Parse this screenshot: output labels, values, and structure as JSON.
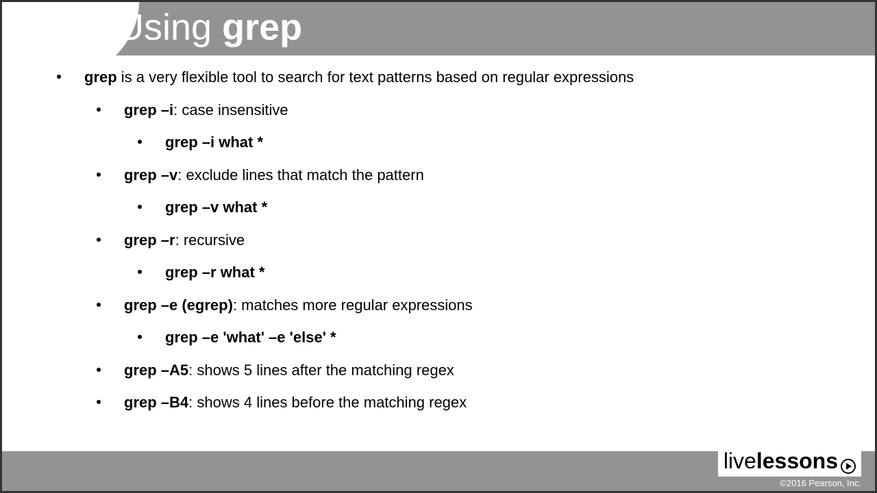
{
  "header": {
    "title_prefix": "Using ",
    "title_bold": "grep"
  },
  "content": {
    "intro_bold": "grep",
    "intro_rest": " is a very flexible tool to search for text patterns based on regular expressions",
    "items": [
      {
        "cmd": "grep –i",
        "desc": ": case insensitive",
        "example": "grep –i what *"
      },
      {
        "cmd": "grep –v",
        "desc": ": exclude lines that match the pattern",
        "example": "grep –v what *"
      },
      {
        "cmd": "grep –r",
        "desc": ": recursive",
        "example": "grep –r what *"
      },
      {
        "cmd": "grep –e (egrep)",
        "desc": ": matches more regular expressions",
        "example": "grep –e 'what' –e 'else' *"
      },
      {
        "cmd": "grep –A5",
        "desc": ": shows 5 lines after the matching regex"
      },
      {
        "cmd": "grep –B4",
        "desc": ": shows 4 lines before the matching regex"
      }
    ]
  },
  "footer": {
    "brand_live": "live",
    "brand_lessons": "lessons",
    "copyright": "©2016 Pearson, Inc."
  }
}
